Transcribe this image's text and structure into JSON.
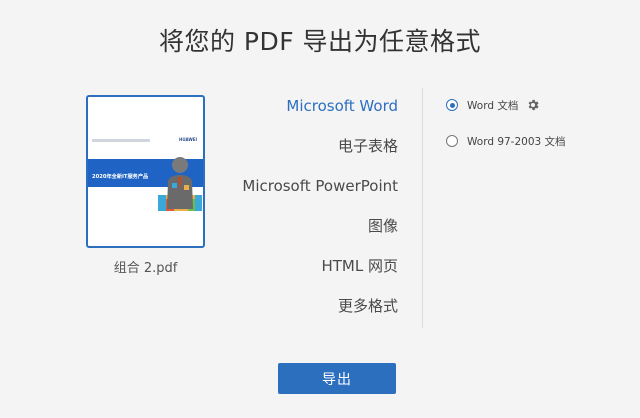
{
  "page": {
    "title": "将您的 PDF 导出为任意格式"
  },
  "file": {
    "name": "组合 2.pdf",
    "thumbnail_banner_text": "2020年全新IT服务产品"
  },
  "formats": [
    {
      "label": "Microsoft Word",
      "selected": true
    },
    {
      "label": "电子表格",
      "selected": false
    },
    {
      "label": "Microsoft PowerPoint",
      "selected": false
    },
    {
      "label": "图像",
      "selected": false
    },
    {
      "label": "HTML 网页",
      "selected": false
    },
    {
      "label": "更多格式",
      "selected": false
    }
  ],
  "options": [
    {
      "label": "Word 文档",
      "checked": true,
      "has_settings": true,
      "settings_icon": "gear-icon"
    },
    {
      "label": "Word 97-2003 文档",
      "checked": false,
      "has_settings": false
    }
  ],
  "actions": {
    "export_label": "导出"
  },
  "colors": {
    "accent": "#2d6fbf",
    "background": "#f4f4f4",
    "text": "#4a4a4a"
  }
}
